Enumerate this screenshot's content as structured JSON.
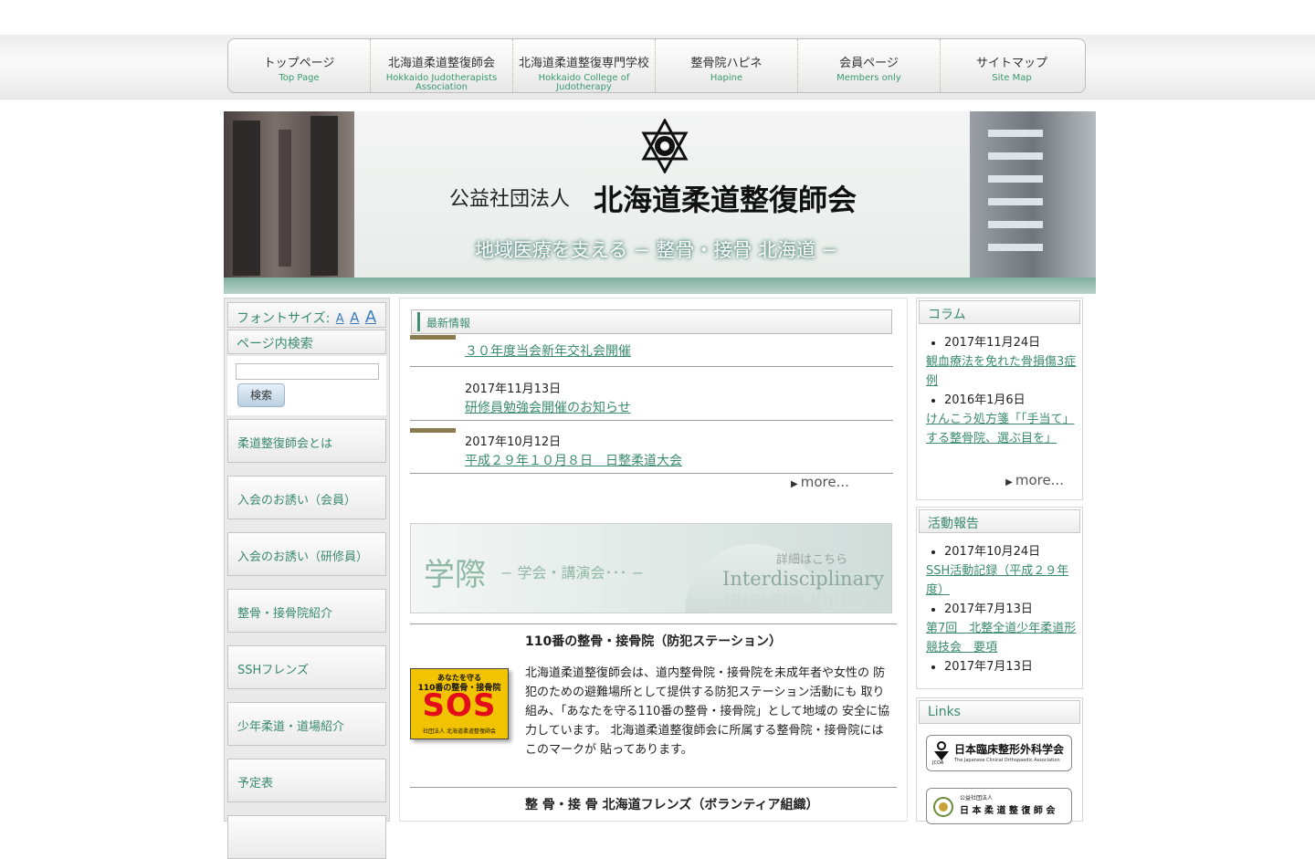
{
  "nav": [
    {
      "jp": "トップページ",
      "en": "Top Page"
    },
    {
      "jp": "北海道柔道整復師会",
      "en": "Hokkaido Judotherapists Association"
    },
    {
      "jp": "北海道柔道整復専門学校",
      "en": "Hokkaido College of Judotherapy"
    },
    {
      "jp": "整骨院ハピネ",
      "en": "Hapine"
    },
    {
      "jp": "会員ページ",
      "en": "Members only"
    },
    {
      "jp": "サイトマップ",
      "en": "Site Map"
    }
  ],
  "banner": {
    "sub": "公益社団法人",
    "title": "北海道柔道整復師会",
    "slogan": "地域医療を支える − 整骨・接骨 北海道 −"
  },
  "sidebar": {
    "font_size_label": "フォントサイズ:",
    "font_size_options": [
      "A",
      "A",
      "A"
    ],
    "search_heading": "ページ内検索",
    "search_value": "",
    "search_button": "検索",
    "menu": [
      "柔道整復師会とは",
      "入会のお誘い（会員）",
      "入会のお誘い（研修員）",
      "整骨・接骨院紹介",
      "SSHフレンズ",
      "少年柔道・道場紹介",
      "予定表"
    ]
  },
  "news": {
    "heading": "最新情報",
    "items": [
      {
        "date": "",
        "title": "３０年度当会新年交礼会開催"
      },
      {
        "date": "2017年11月13日",
        "title": "研修員勉強会開催のお知らせ"
      },
      {
        "date": "2017年10月12日",
        "title": "平成２９年１０月８日　日整柔道大会"
      }
    ],
    "more": "more..."
  },
  "gakusai": {
    "big": "学際",
    "mid": "− 学会・講演会･･･ −",
    "detail": "詳細はこちら",
    "en": "Interdisciplinary"
  },
  "sos": {
    "title": "110番の整骨・接骨院（防犯ステーション）",
    "badge_top": "あなたを守る",
    "badge_mid": "110番の整骨・接骨院",
    "badge_big": "SOS",
    "badge_foot": "社団法人 北海道柔道整復師会",
    "text": "北海道柔道整復師会は、道内整骨院・接骨院を未成年者や女性の 防犯のための避難場所として提供する防犯ステーション活動にも 取り組み、「あなたを守る110番の整骨・接骨院」として地域の 安全に協力しています。 北海道柔道整復師会に所属する整骨院・接骨院にはこのマークが 貼ってあります。"
  },
  "friends": {
    "title": "整 骨・接 骨 北海道フレンズ（ボランティア組織）"
  },
  "column": {
    "heading": "コラム",
    "items": [
      {
        "date": "2017年11月24日",
        "title": "観血療法を免れた骨損傷3症例"
      },
      {
        "date": "2016年1月6日",
        "title": "けんこう処方箋「「手当て」する整骨院、選ぶ目を」"
      }
    ],
    "more": "more..."
  },
  "activity": {
    "heading": "活動報告",
    "items": [
      {
        "date": "2017年10月24日",
        "title": "SSH活動記録（平成２９年度）"
      },
      {
        "date": "2017年7月13日",
        "title": "第7回　北整全道少年柔道形競技会　要項"
      },
      {
        "date": "2017年7月13日",
        "title": ""
      }
    ]
  },
  "links": {
    "heading": "Links",
    "items": [
      {
        "jp": "日本臨床整形外科学会",
        "en": "The Japanese Clinical Orthopaedic Association",
        "mark": "JCOA"
      },
      {
        "jp_small": "公益社団法人",
        "jp": "日 本 柔 道 整 復 師 会"
      }
    ]
  }
}
